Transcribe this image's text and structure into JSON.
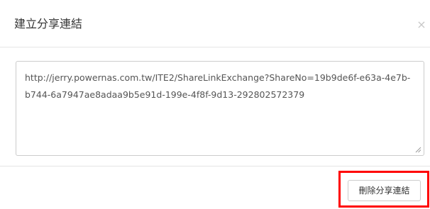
{
  "dialog": {
    "title": "建立分享連結",
    "close_glyph": "×",
    "close_icon": "close-icon"
  },
  "share_link": {
    "value": "http://jerry.powernas.com.tw/ITE2/ShareLinkExchange?ShareNo=19b9de6f-e63a-4e7b-b744-6a7947ae8adaa9b5e91d-199e-4f8f-9d13-292802572379"
  },
  "footer": {
    "delete_label": "刪除分享連結",
    "highlight_color": "#ff0000"
  }
}
